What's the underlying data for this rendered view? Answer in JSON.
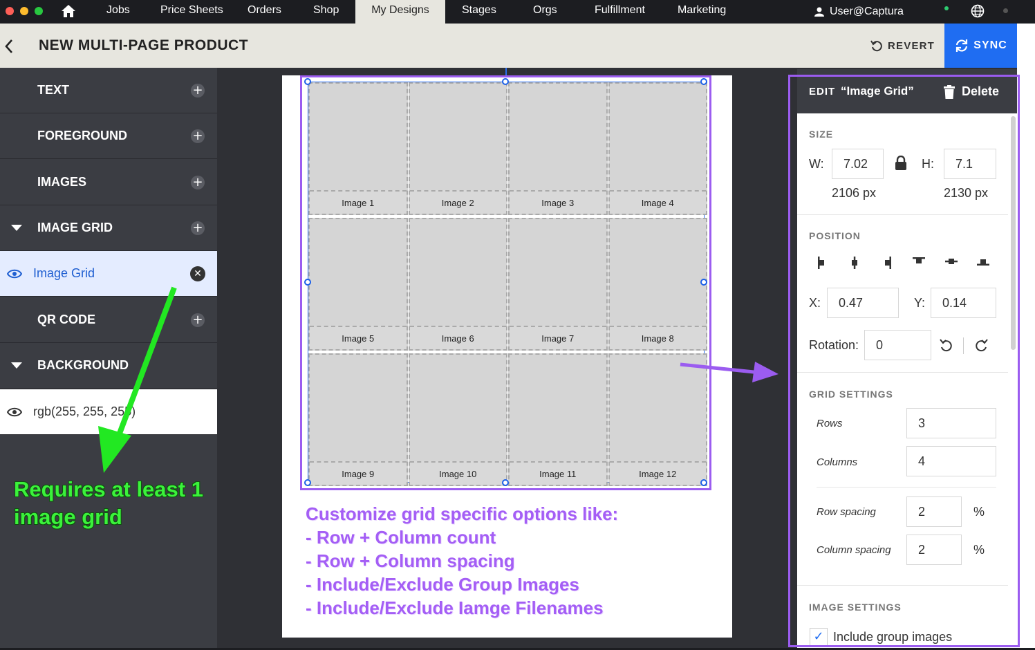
{
  "nav": {
    "items": [
      "Jobs",
      "Price Sheets",
      "Orders",
      "Shop",
      "My Designs",
      "Stages",
      "Orgs",
      "Fulfillment",
      "Marketing"
    ],
    "active": "My Designs",
    "user": "User@Captura"
  },
  "header": {
    "title": "NEW MULTI-PAGE PRODUCT",
    "revert": "REVERT",
    "sync": "SYNC"
  },
  "sidebar": {
    "sections": {
      "text": "TEXT",
      "foreground": "FOREGROUND",
      "images": "IMAGES",
      "image_grid": "IMAGE GRID",
      "qr_code": "QR CODE",
      "background": "BACKGROUND"
    },
    "image_grid_item": "Image Grid",
    "background_item": "rgb(255, 255, 255)"
  },
  "canvas": {
    "cells": [
      "Image 1",
      "Image 2",
      "Image 3",
      "Image 4",
      "Image 5",
      "Image 6",
      "Image 7",
      "Image 8",
      "Image 9",
      "Image 10",
      "Image 11",
      "Image 12"
    ]
  },
  "annotations": {
    "green": [
      "Requires at least 1",
      "image grid"
    ],
    "purple": [
      "Customize grid specific options like:",
      "- Row + Column count",
      "- Row + Column spacing",
      "- Include/Exclude Group Images",
      "- Include/Exclude Iamge Filenames"
    ]
  },
  "panel": {
    "edit_label": "EDIT",
    "edit_name": "“Image Grid”",
    "delete": "Delete",
    "size": {
      "heading": "SIZE",
      "w_label": "W:",
      "w": "7.02",
      "w_px": "2106 px",
      "h_label": "H:",
      "h": "7.1",
      "h_px": "2130 px"
    },
    "position": {
      "heading": "POSITION",
      "x_label": "X:",
      "x": "0.47",
      "y_label": "Y:",
      "y": "0.14",
      "rotation_label": "Rotation:",
      "rotation": "0"
    },
    "grid": {
      "heading": "GRID SETTINGS",
      "rows_label": "Rows",
      "rows": "3",
      "columns_label": "Columns",
      "columns": "4",
      "row_spacing_label": "Row spacing",
      "row_spacing": "2",
      "column_spacing_label": "Column spacing",
      "column_spacing": "2",
      "unit": "%"
    },
    "image_settings": {
      "heading": "IMAGE SETTINGS",
      "include_group": "Include group images"
    }
  },
  "colors": {
    "accent": "#1f6df2",
    "annotation_purple": "#9b5cf0",
    "annotation_green": "#3bf23b",
    "sidebar": "#3b3d43",
    "topnav": "#1c1d21"
  }
}
